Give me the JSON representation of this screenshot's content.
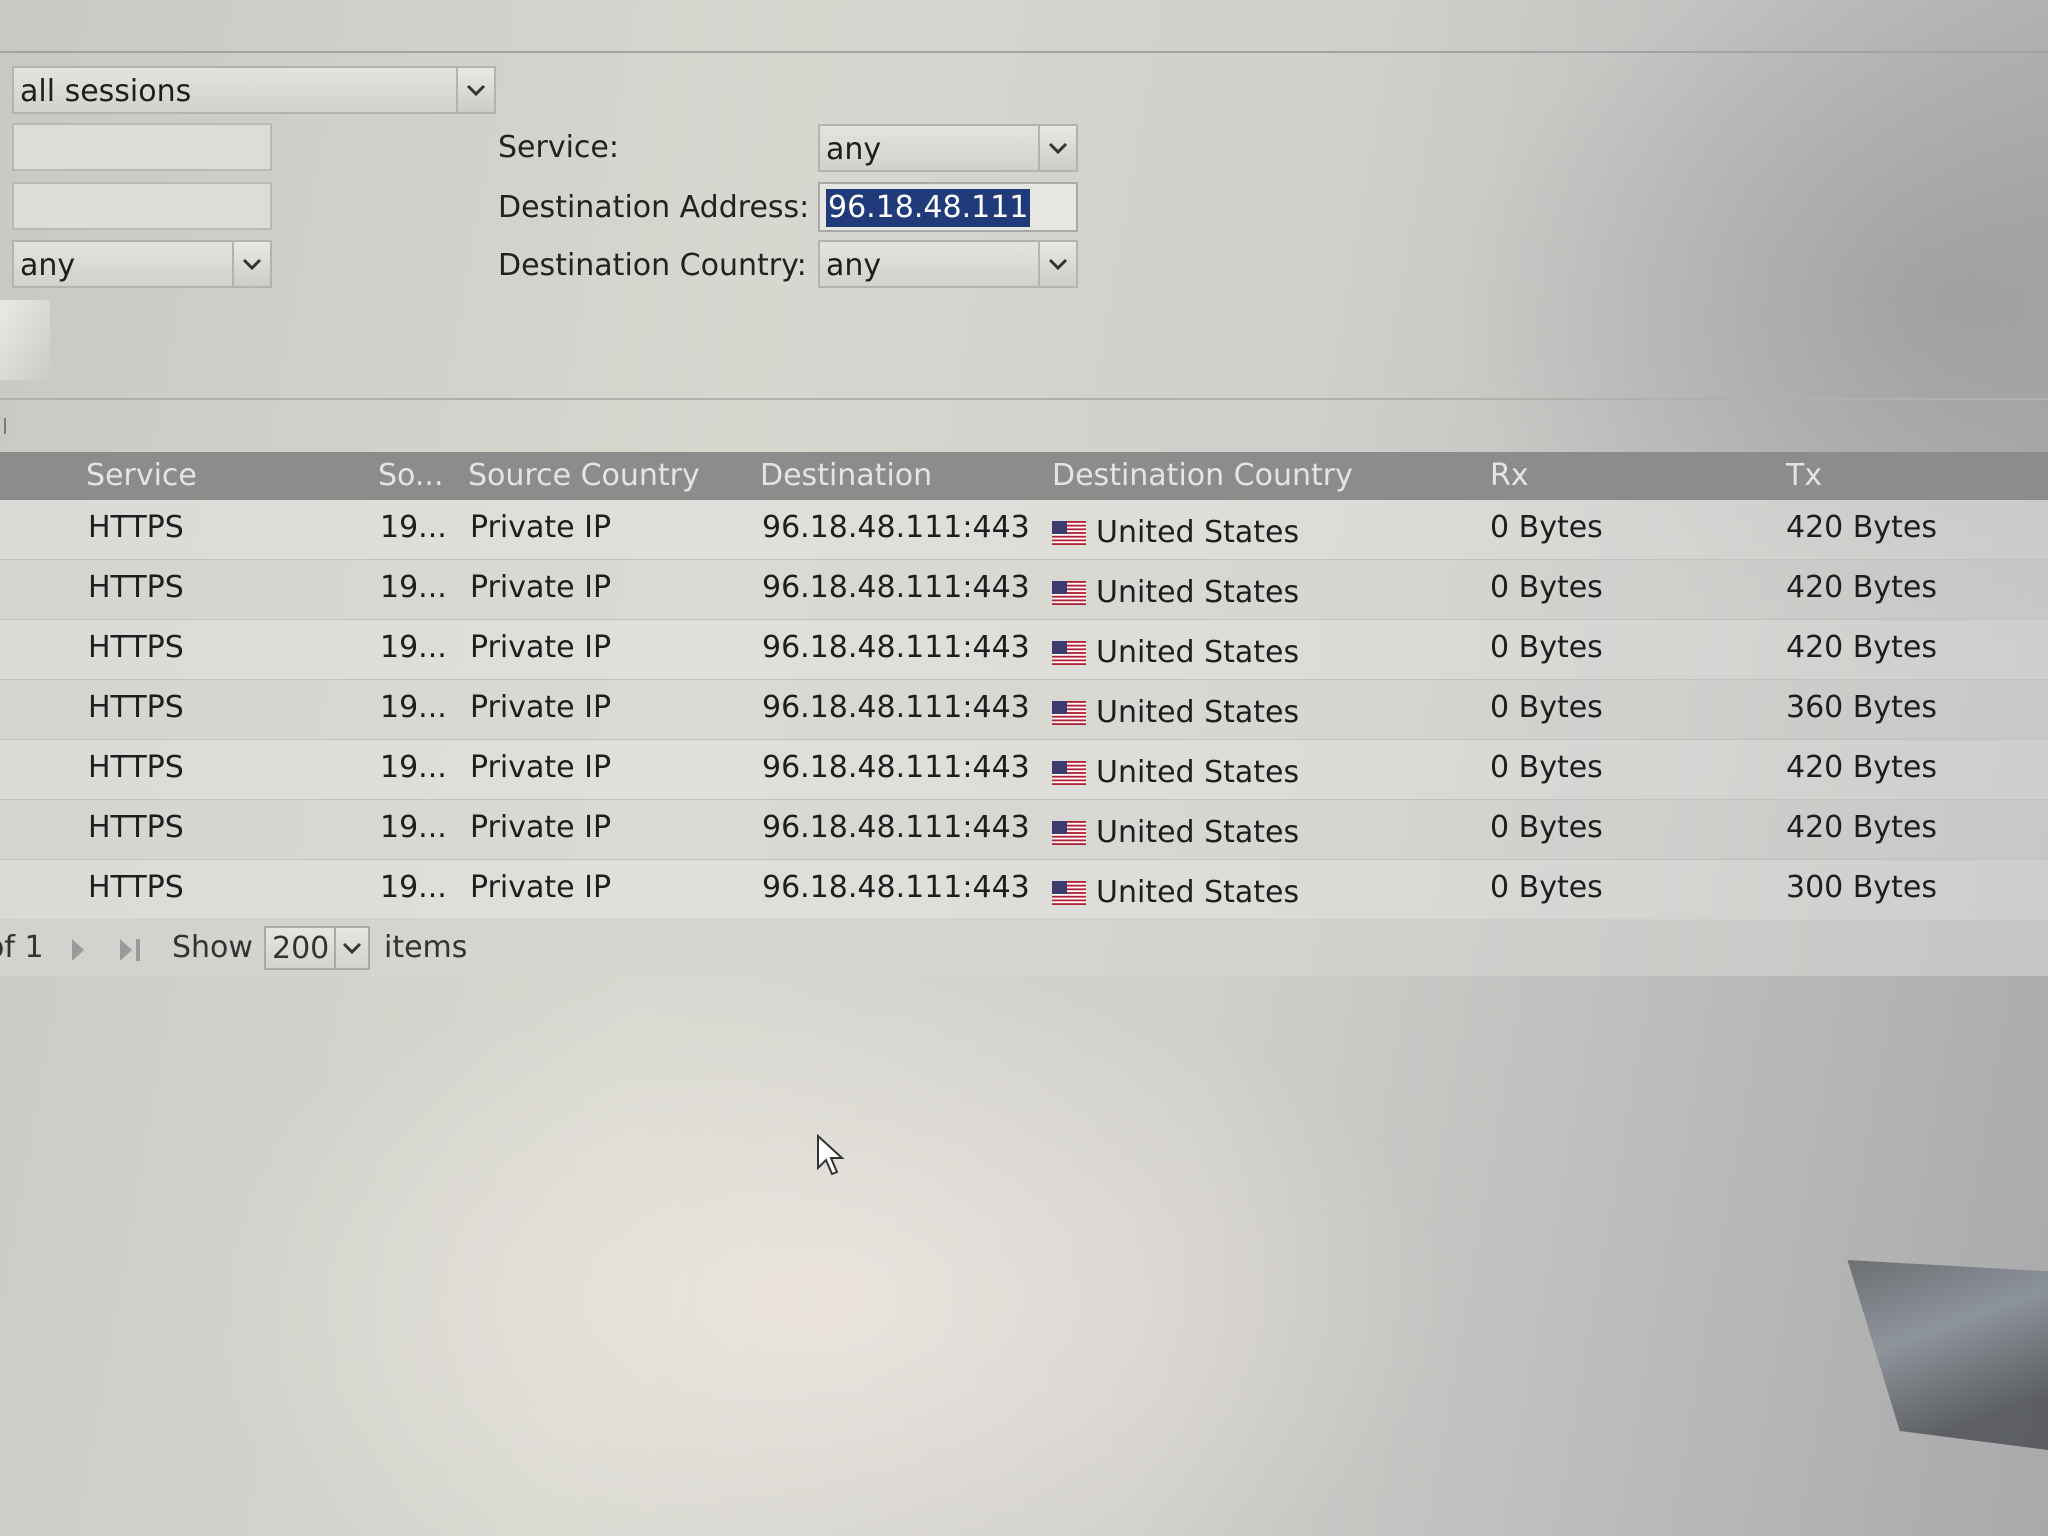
{
  "filters": {
    "session_scope": "all sessions",
    "left_field_1": "",
    "left_field_2": "",
    "left_select": "any",
    "service_label": "Service:",
    "service_value": "any",
    "dest_address_label": "Destination Address:",
    "dest_address_value": "96.18.48.111",
    "dest_country_label": "Destination Country:",
    "dest_country_value": "any"
  },
  "table": {
    "columns": [
      "Service",
      "So...",
      "Source Country",
      "Destination",
      "Destination Country",
      "Rx",
      "Tx"
    ],
    "rows": [
      {
        "service": "HTTPS",
        "source": "19...",
        "source_country": "Private IP",
        "destination": "96.18.48.111:443",
        "destination_country": "United States",
        "rx": "0 Bytes",
        "tx": "420 Bytes"
      },
      {
        "service": "HTTPS",
        "source": "19...",
        "source_country": "Private IP",
        "destination": "96.18.48.111:443",
        "destination_country": "United States",
        "rx": "0 Bytes",
        "tx": "420 Bytes"
      },
      {
        "service": "HTTPS",
        "source": "19...",
        "source_country": "Private IP",
        "destination": "96.18.48.111:443",
        "destination_country": "United States",
        "rx": "0 Bytes",
        "tx": "420 Bytes"
      },
      {
        "service": "HTTPS",
        "source": "19...",
        "source_country": "Private IP",
        "destination": "96.18.48.111:443",
        "destination_country": "United States",
        "rx": "0 Bytes",
        "tx": "360 Bytes"
      },
      {
        "service": "HTTPS",
        "source": "19...",
        "source_country": "Private IP",
        "destination": "96.18.48.111:443",
        "destination_country": "United States",
        "rx": "0 Bytes",
        "tx": "420 Bytes"
      },
      {
        "service": "HTTPS",
        "source": "19...",
        "source_country": "Private IP",
        "destination": "96.18.48.111:443",
        "destination_country": "United States",
        "rx": "0 Bytes",
        "tx": "420 Bytes"
      },
      {
        "service": "HTTPS",
        "source": "19...",
        "source_country": "Private IP",
        "destination": "96.18.48.111:443",
        "destination_country": "United States",
        "rx": "0 Bytes",
        "tx": "300 Bytes"
      }
    ]
  },
  "pager": {
    "of_text": "of 1",
    "show_label": "Show",
    "page_size": "200",
    "items_label": "items"
  },
  "icons": {
    "dropdown": "chevron-down-icon",
    "flag": "us-flag-icon",
    "next": "next-page-icon",
    "last": "last-page-icon",
    "cursor": "mouse-pointer-icon"
  },
  "colors": {
    "header_bg": "#8c8c8d",
    "selection": "#213a7a"
  }
}
